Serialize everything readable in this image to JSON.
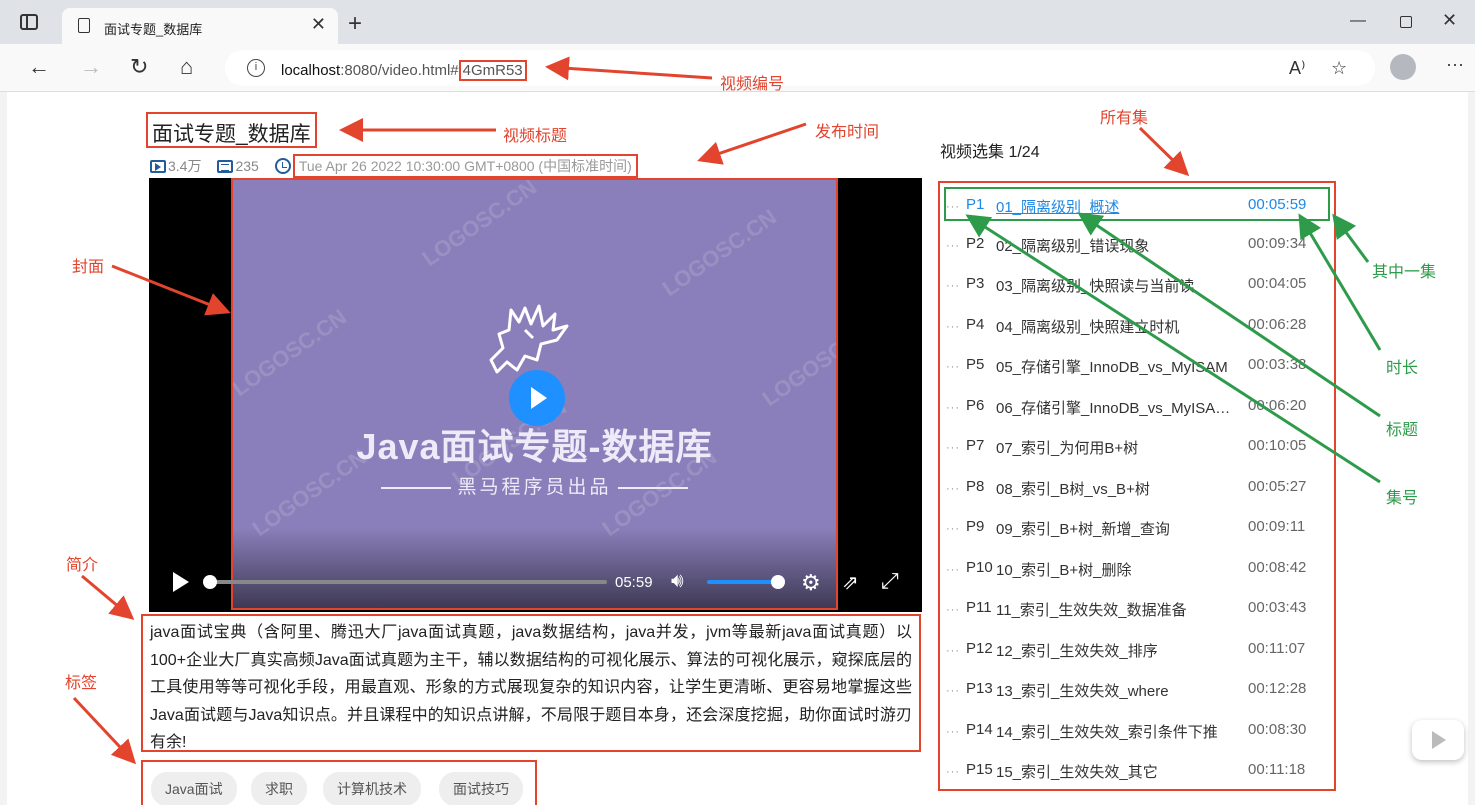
{
  "browser": {
    "tab_title": "面试专题_数据库",
    "url_host": "localhost",
    "url_rest": ":8080/video.html#",
    "url_hash": "4GmR53"
  },
  "video": {
    "title": "面试专题_数据库",
    "plays": "3.4万",
    "danmaku": "235",
    "publish_time": "Tue Apr 26 2022 10:30:00 GMT+0800 (中国标准时间)",
    "cover_title": "Java面试专题-数据库",
    "cover_subtitle": "黑马程序员出品",
    "watermark": "LOGOSC.CN",
    "current_time": "05:59",
    "volume": 0.95,
    "progress": 0.0
  },
  "intro": "java面试宝典（含阿里、腾迅大厂java面试真题，java数据结构，java并发，jvm等最新java面试真题）以100+企业大厂真实高频Java面试真题为主干，辅以数据结构的可视化展示、算法的可视化展示，窥探底层的工具使用等等可视化手段，用最直观、形象的方式展现复杂的知识内容，让学生更清晰、更容易地掌握这些Java面试题与Java知识点。并且课程中的知识点讲解，不局限于题目本身，还会深度挖掘，助你面试时游刃有余!",
  "tags": [
    "Java面试",
    "求职",
    "计算机技术",
    "面试技巧"
  ],
  "episodes_header": "视频选集 1/24",
  "episodes": [
    {
      "num": "P1",
      "name": "01_隔离级别_概述",
      "dur": "00:05:59"
    },
    {
      "num": "P2",
      "name": "02_隔离级别_错误现象",
      "dur": "00:09:34"
    },
    {
      "num": "P3",
      "name": "03_隔离级别_快照读与当前读",
      "dur": "00:04:05"
    },
    {
      "num": "P4",
      "name": "04_隔离级别_快照建立时机",
      "dur": "00:06:28"
    },
    {
      "num": "P5",
      "name": "05_存储引擎_InnoDB_vs_MyISAM",
      "dur": "00:03:38"
    },
    {
      "num": "P6",
      "name": "06_存储引擎_InnoDB_vs_MyISAM_...",
      "dur": "00:06:20"
    },
    {
      "num": "P7",
      "name": "07_索引_为何用B+树",
      "dur": "00:10:05"
    },
    {
      "num": "P8",
      "name": "08_索引_B树_vs_B+树",
      "dur": "00:05:27"
    },
    {
      "num": "P9",
      "name": "09_索引_B+树_新增_查询",
      "dur": "00:09:11"
    },
    {
      "num": "P10",
      "name": "10_索引_B+树_删除",
      "dur": "00:08:42"
    },
    {
      "num": "P11",
      "name": "11_索引_生效失效_数据准备",
      "dur": "00:03:43"
    },
    {
      "num": "P12",
      "name": "12_索引_生效失效_排序",
      "dur": "00:11:07"
    },
    {
      "num": "P13",
      "name": "13_索引_生效失效_where",
      "dur": "00:12:28"
    },
    {
      "num": "P14",
      "name": "14_索引_生效失效_索引条件下推",
      "dur": "00:08:30"
    },
    {
      "num": "P15",
      "name": "15_索引_生效失效_其它",
      "dur": "00:11:18"
    }
  ],
  "annotations": {
    "video_id": "视频编号",
    "video_title": "视频标题",
    "publish_time": "发布时间",
    "all_episodes": "所有集",
    "cover": "封面",
    "one_episode": "其中一集",
    "duration": "时长",
    "ep_title": "标题",
    "ep_number": "集号",
    "intro": "简介",
    "tags": "标签"
  },
  "colors": {
    "annotation_red": "#e2442e",
    "annotation_green": "#2e9b4b",
    "cover_bg": "#8a7fba",
    "accent": "#1e90ff"
  }
}
